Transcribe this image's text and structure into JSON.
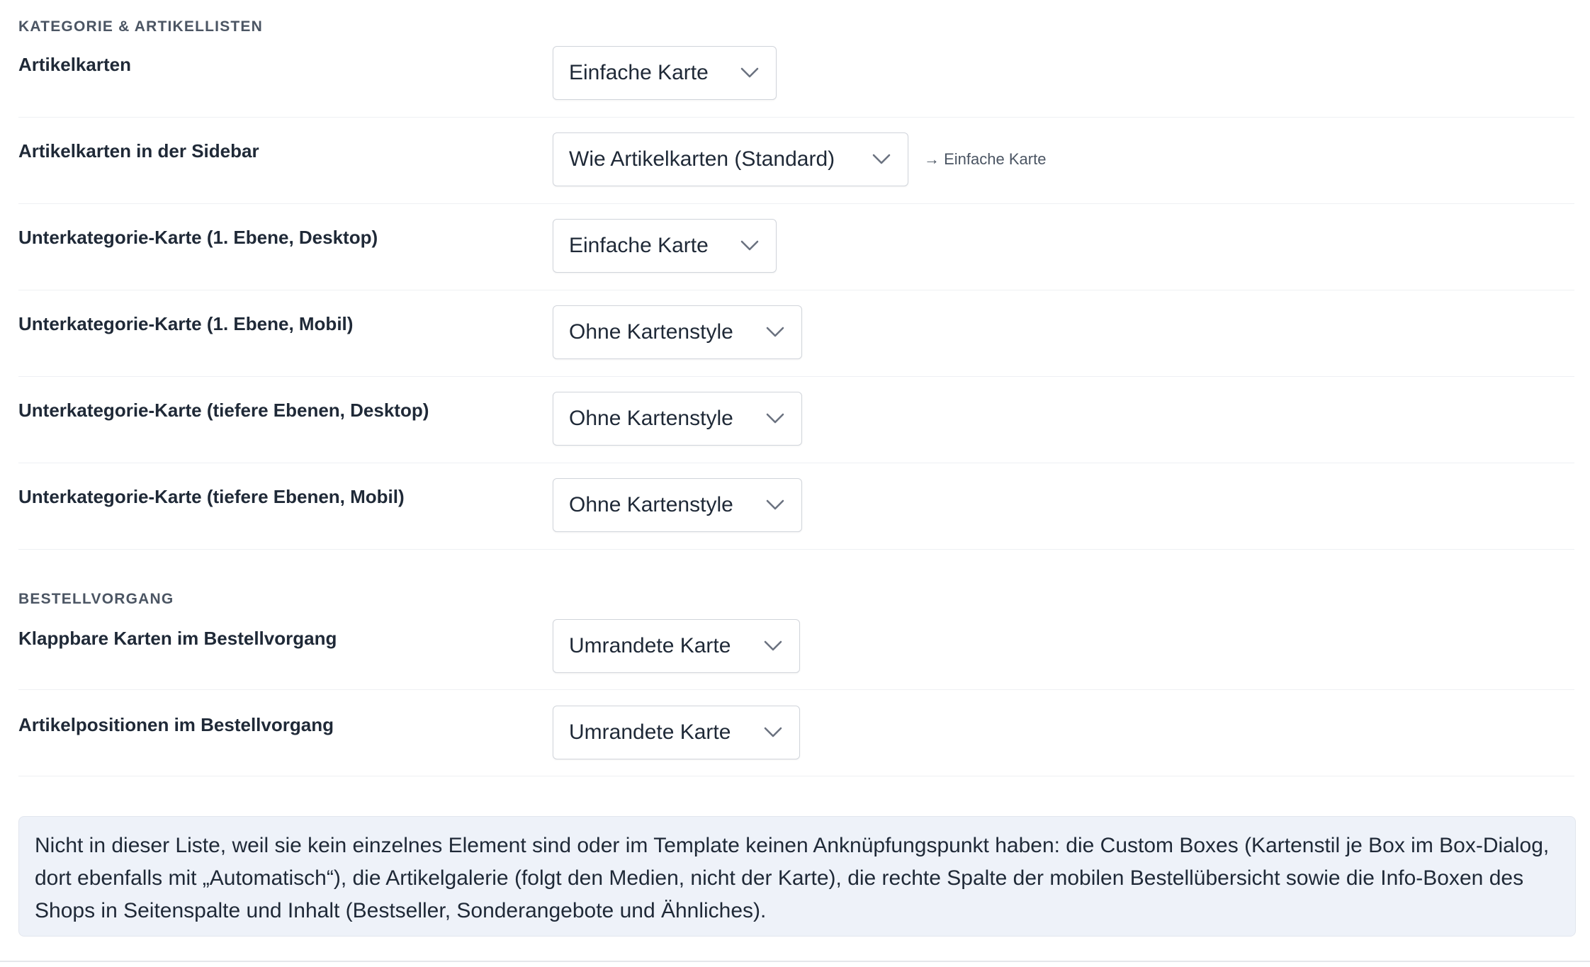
{
  "sections": {
    "category": {
      "title": "KATEGORIE & ARTIKELLISTEN",
      "rows": [
        {
          "label": "Artikelkarten",
          "value": "Einfache Karte"
        },
        {
          "label": "Artikelkarten in der Sidebar",
          "value": "Wie Artikelkarten (Standard)",
          "hint": "→ Einfache Karte"
        },
        {
          "label": "Unterkategorie-Karte (1. Ebene, Desktop)",
          "value": "Einfache Karte"
        },
        {
          "label": "Unterkategorie-Karte (1. Ebene, Mobil)",
          "value": "Ohne Kartenstyle"
        },
        {
          "label": "Unterkategorie-Karte (tiefere Ebenen, Desktop)",
          "value": "Ohne Kartenstyle"
        },
        {
          "label": "Unterkategorie-Karte (tiefere Ebenen, Mobil)",
          "value": "Ohne Kartenstyle"
        }
      ]
    },
    "checkout": {
      "title": "BESTELLVORGANG",
      "rows": [
        {
          "label": "Klappbare Karten im Bestellvorgang",
          "value": "Umrandete Karte"
        },
        {
          "label": "Artikelpositionen im Bestellvorgang",
          "value": "Umrandete Karte"
        }
      ]
    }
  },
  "info_note": "Nicht in dieser Liste, weil sie kein einzelnes Element sind oder im Template keinen Anknüpfungspunkt haben: die Custom Boxes (Kartenstil je Box im Box-Dialog, dort ebenfalls mit „Automatisch“), die Artikelgalerie (folgt den Medien, nicht der Karte), die rechte Spalte der mobilen Bestellübersicht sowie die Info-Boxen des Shops in Seitenspalte und Inhalt (Bestseller, Sonderangebote und Ähnliches).",
  "icons": {
    "select_chevron": "chevron-down-icon"
  },
  "colors": {
    "info_bg": "#eef2f9",
    "section_title": "#4b5563",
    "text": "#1f2937"
  }
}
